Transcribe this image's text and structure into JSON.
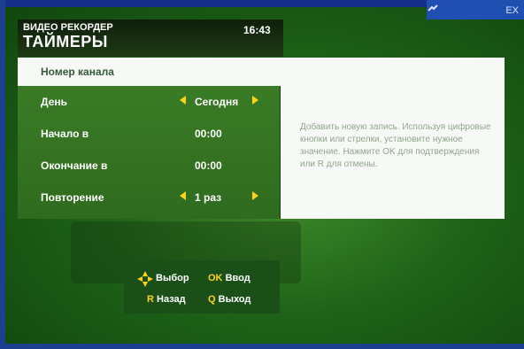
{
  "top_right": {
    "text": "EX"
  },
  "header": {
    "sub": "ВИДЕО РЕКОРДЕР",
    "title": "ТАЙМЕРЫ",
    "clock": "16:43"
  },
  "channel": {
    "label": "Номер канала"
  },
  "rows": [
    {
      "label": "День",
      "value": "Сегодня"
    },
    {
      "label": "Начало в",
      "value": "00:00"
    },
    {
      "label": "Окончание в",
      "value": "00:00"
    },
    {
      "label": "Повторение",
      "value": "1 раз"
    }
  ],
  "help": "Добавить новую запись. Используя цифровые кнопки или стрелки, установите нужное значение. Нажмите OK для подтверждения или R для отмены.",
  "keys": {
    "select_label": "Выбор",
    "ok_key": "OK",
    "ok_label": "Ввод",
    "back_key": "R",
    "back_label": "Назад",
    "exit_key": "Q",
    "exit_label": "Выход"
  }
}
